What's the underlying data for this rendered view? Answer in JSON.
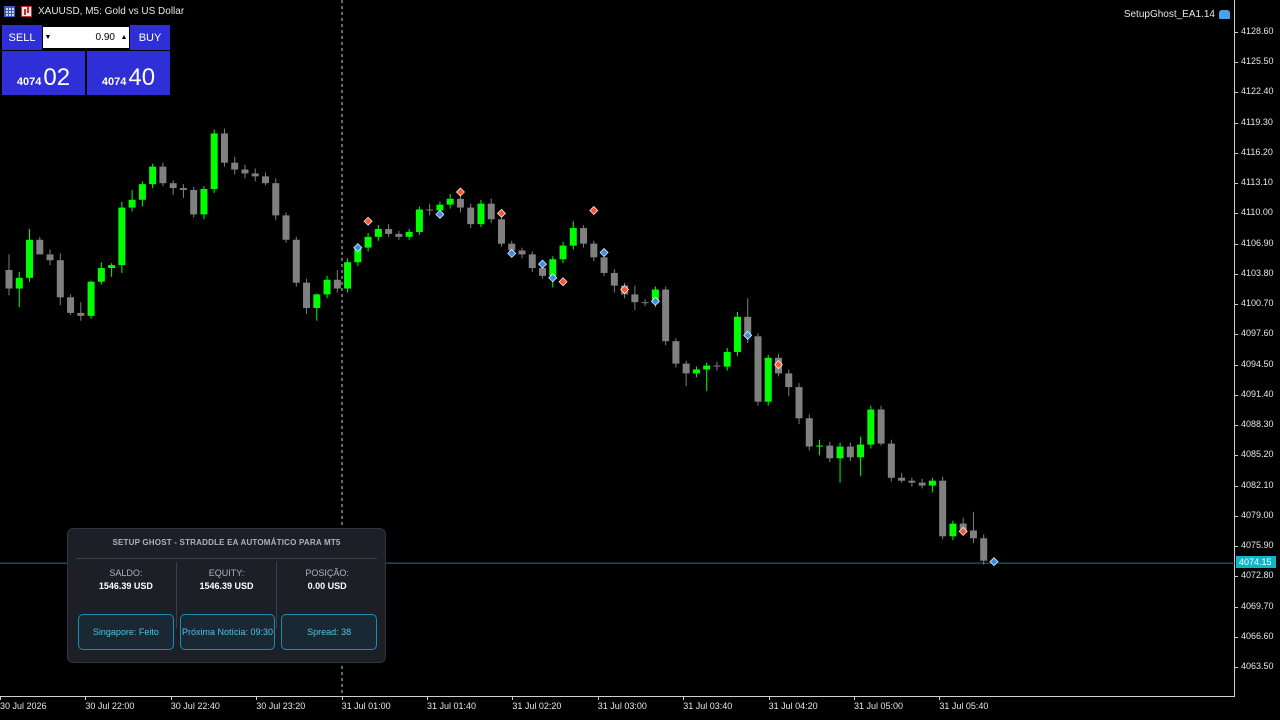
{
  "window": {
    "symbol_title": "XAUUSD, M5:  Gold vs US Dollar",
    "ea_name": "SetupGhost_EA1.14",
    "icons": [
      "chart-grid-icon",
      "chart-bars-icon",
      "expert-hat-icon"
    ]
  },
  "one_click": {
    "sell_label": "SELL",
    "buy_label": "BUY",
    "volume": "0.90",
    "bid_small": "4074",
    "bid_big": "02",
    "ask_small": "4074",
    "ask_big": "40",
    "color": "#2f2fd7"
  },
  "price_axis": {
    "ticks": [
      "4128.60",
      "4125.50",
      "4122.40",
      "4119.30",
      "4116.20",
      "4113.10",
      "4110.00",
      "4106.90",
      "4103.80",
      "4100.70",
      "4097.60",
      "4094.50",
      "4091.40",
      "4088.30",
      "4085.20",
      "4082.10",
      "4079.00",
      "4075.90",
      "4072.80",
      "4069.70",
      "4066.60",
      "4063.50"
    ],
    "current_price": "4074.15",
    "current_price_color": "#0fb6c8"
  },
  "time_axis": {
    "labels": [
      "30 Jul 2026",
      "30 Jul 22:00",
      "30 Jul 22:40",
      "30 Jul 23:20",
      "31 Jul 01:00",
      "31 Jul 01:40",
      "31 Jul 02:20",
      "31 Jul 03:00",
      "31 Jul 03:40",
      "31 Jul 04:20",
      "31 Jul 05:00",
      "31 Jul 05:40"
    ]
  },
  "dashboard": {
    "title": "SETUP GHOST - STRADDLE EA AUTOMÁTICO PARA MT5",
    "saldo_label": "SALDO:",
    "saldo_value": "1546.39 USD",
    "equity_label": "EQUITY:",
    "equity_value": "1546.39 USD",
    "posicao_label": "POSIÇÃO:",
    "posicao_value": "0.00 USD",
    "session_button": "Singapore: Feito",
    "news_button": "Próxima Notícia: 09:30",
    "spread_button": "Spread: 38"
  },
  "chart_data": {
    "type": "candlestick",
    "bull_color": "#00ff00",
    "bear_color": "#808080",
    "y_range": [
      4061.9,
      4130.1
    ],
    "candles": [
      {
        "o": 4104.2,
        "h": 4105.8,
        "l": 4101.6,
        "c": 4102.3
      },
      {
        "o": 4102.3,
        "h": 4104.0,
        "l": 4100.4,
        "c": 4103.4
      },
      {
        "o": 4103.4,
        "h": 4108.4,
        "l": 4103.0,
        "c": 4107.3
      },
      {
        "o": 4107.3,
        "h": 4107.6,
        "l": 4105.8,
        "c": 4105.8
      },
      {
        "o": 4105.8,
        "h": 4106.3,
        "l": 4104.7,
        "c": 4105.2
      },
      {
        "o": 4105.2,
        "h": 4105.9,
        "l": 4100.6,
        "c": 4101.4
      },
      {
        "o": 4101.4,
        "h": 4101.7,
        "l": 4099.6,
        "c": 4099.8
      },
      {
        "o": 4099.8,
        "h": 4100.9,
        "l": 4099.0,
        "c": 4099.5
      },
      {
        "o": 4099.5,
        "h": 4103.1,
        "l": 4099.2,
        "c": 4103.0
      },
      {
        "o": 4103.0,
        "h": 4105.0,
        "l": 4102.7,
        "c": 4104.4
      },
      {
        "o": 4104.4,
        "h": 4104.9,
        "l": 4103.5,
        "c": 4104.7
      },
      {
        "o": 4104.7,
        "h": 4111.2,
        "l": 4103.9,
        "c": 4110.6
      },
      {
        "o": 4110.6,
        "h": 4112.4,
        "l": 4110.2,
        "c": 4111.4
      },
      {
        "o": 4111.4,
        "h": 4113.3,
        "l": 4110.7,
        "c": 4113.0
      },
      {
        "o": 4113.0,
        "h": 4115.1,
        "l": 4112.6,
        "c": 4114.8
      },
      {
        "o": 4114.8,
        "h": 4115.2,
        "l": 4112.8,
        "c": 4113.1
      },
      {
        "o": 4113.1,
        "h": 4113.4,
        "l": 4111.9,
        "c": 4112.6
      },
      {
        "o": 4112.6,
        "h": 4113.0,
        "l": 4111.6,
        "c": 4112.4
      },
      {
        "o": 4112.4,
        "h": 4112.7,
        "l": 4109.6,
        "c": 4109.9
      },
      {
        "o": 4109.9,
        "h": 4112.8,
        "l": 4109.4,
        "c": 4112.5
      },
      {
        "o": 4112.5,
        "h": 4118.6,
        "l": 4112.1,
        "c": 4118.2
      },
      {
        "o": 4118.2,
        "h": 4118.7,
        "l": 4114.8,
        "c": 4115.2
      },
      {
        "o": 4115.2,
        "h": 4115.8,
        "l": 4114.0,
        "c": 4114.5
      },
      {
        "o": 4114.5,
        "h": 4115.0,
        "l": 4113.6,
        "c": 4114.1
      },
      {
        "o": 4114.1,
        "h": 4114.6,
        "l": 4113.3,
        "c": 4113.8
      },
      {
        "o": 4113.8,
        "h": 4114.2,
        "l": 4112.9,
        "c": 4113.1
      },
      {
        "o": 4113.1,
        "h": 4113.6,
        "l": 4109.3,
        "c": 4109.8
      },
      {
        "o": 4109.8,
        "h": 4110.1,
        "l": 4107.0,
        "c": 4107.3
      },
      {
        "o": 4107.3,
        "h": 4107.6,
        "l": 4102.5,
        "c": 4102.9
      },
      {
        "o": 4102.9,
        "h": 4103.3,
        "l": 4099.7,
        "c": 4100.3
      },
      {
        "o": 4100.3,
        "h": 4101.8,
        "l": 4099.0,
        "c": 4101.7
      },
      {
        "o": 4101.7,
        "h": 4103.6,
        "l": 4101.3,
        "c": 4103.2
      },
      {
        "o": 4103.2,
        "h": 4104.2,
        "l": 4101.9,
        "c": 4102.3
      },
      {
        "o": 4102.3,
        "h": 4105.4,
        "l": 4101.9,
        "c": 4105.0
      },
      {
        "o": 4105.0,
        "h": 4106.9,
        "l": 4104.6,
        "c": 4106.5
      },
      {
        "o": 4106.5,
        "h": 4108.0,
        "l": 4106.1,
        "c": 4107.6
      },
      {
        "o": 4107.6,
        "h": 4108.8,
        "l": 4107.2,
        "c": 4108.4
      },
      {
        "o": 4108.4,
        "h": 4108.9,
        "l": 4107.6,
        "c": 4107.9
      },
      {
        "o": 4107.9,
        "h": 4108.2,
        "l": 4107.3,
        "c": 4107.6
      },
      {
        "o": 4107.6,
        "h": 4108.4,
        "l": 4107.3,
        "c": 4108.1
      },
      {
        "o": 4108.1,
        "h": 4110.7,
        "l": 4107.8,
        "c": 4110.4
      },
      {
        "o": 4110.4,
        "h": 4111.0,
        "l": 4109.8,
        "c": 4110.3
      },
      {
        "o": 4110.3,
        "h": 4111.2,
        "l": 4109.9,
        "c": 4110.9
      },
      {
        "o": 4110.9,
        "h": 4112.0,
        "l": 4110.5,
        "c": 4111.5
      },
      {
        "o": 4111.5,
        "h": 4111.9,
        "l": 4110.1,
        "c": 4110.6
      },
      {
        "o": 4110.6,
        "h": 4111.0,
        "l": 4108.5,
        "c": 4108.9
      },
      {
        "o": 4108.9,
        "h": 4111.4,
        "l": 4108.6,
        "c": 4111.0
      },
      {
        "o": 4111.0,
        "h": 4111.5,
        "l": 4109.0,
        "c": 4109.4
      },
      {
        "o": 4109.4,
        "h": 4109.8,
        "l": 4106.6,
        "c": 4106.9
      },
      {
        "o": 4106.9,
        "h": 4107.2,
        "l": 4105.9,
        "c": 4106.2
      },
      {
        "o": 4106.2,
        "h": 4106.5,
        "l": 4105.4,
        "c": 4105.8
      },
      {
        "o": 4105.8,
        "h": 4106.1,
        "l": 4104.0,
        "c": 4104.4
      },
      {
        "o": 4104.4,
        "h": 4104.7,
        "l": 4103.3,
        "c": 4103.6
      },
      {
        "o": 4103.6,
        "h": 4105.6,
        "l": 4102.4,
        "c": 4105.3
      },
      {
        "o": 4105.3,
        "h": 4107.1,
        "l": 4104.9,
        "c": 4106.7
      },
      {
        "o": 4106.7,
        "h": 4109.2,
        "l": 4106.3,
        "c": 4108.5
      },
      {
        "o": 4108.5,
        "h": 4108.8,
        "l": 4106.5,
        "c": 4106.9
      },
      {
        "o": 4106.9,
        "h": 4107.2,
        "l": 4105.1,
        "c": 4105.5
      },
      {
        "o": 4105.5,
        "h": 4105.9,
        "l": 4103.6,
        "c": 4103.9
      },
      {
        "o": 4103.9,
        "h": 4104.3,
        "l": 4101.9,
        "c": 4102.6
      },
      {
        "o": 4102.6,
        "h": 4102.9,
        "l": 4101.3,
        "c": 4101.7
      },
      {
        "o": 4101.7,
        "h": 4102.6,
        "l": 4100.1,
        "c": 4100.9
      },
      {
        "o": 4100.9,
        "h": 4101.2,
        "l": 4100.5,
        "c": 4100.8
      },
      {
        "o": 4100.8,
        "h": 4102.5,
        "l": 4100.4,
        "c": 4102.2
      },
      {
        "o": 4102.2,
        "h": 4102.5,
        "l": 4096.5,
        "c": 4096.9
      },
      {
        "o": 4096.9,
        "h": 4097.2,
        "l": 4094.2,
        "c": 4094.6
      },
      {
        "o": 4094.6,
        "h": 4094.9,
        "l": 4092.3,
        "c": 4093.6
      },
      {
        "o": 4093.6,
        "h": 4094.3,
        "l": 4093.2,
        "c": 4094.0
      },
      {
        "o": 4094.0,
        "h": 4094.7,
        "l": 4091.8,
        "c": 4094.4
      },
      {
        "o": 4094.4,
        "h": 4094.8,
        "l": 4093.9,
        "c": 4094.3
      },
      {
        "o": 4094.3,
        "h": 4096.2,
        "l": 4093.9,
        "c": 4095.8
      },
      {
        "o": 4095.8,
        "h": 4099.9,
        "l": 4095.4,
        "c": 4099.4
      },
      {
        "o": 4099.4,
        "h": 4101.3,
        "l": 4096.7,
        "c": 4097.4
      },
      {
        "o": 4097.4,
        "h": 4097.7,
        "l": 4090.3,
        "c": 4090.7
      },
      {
        "o": 4090.7,
        "h": 4095.5,
        "l": 4090.3,
        "c": 4095.2
      },
      {
        "o": 4095.2,
        "h": 4095.6,
        "l": 4093.3,
        "c": 4093.6
      },
      {
        "o": 4093.6,
        "h": 4094.0,
        "l": 4091.3,
        "c": 4092.2
      },
      {
        "o": 4092.2,
        "h": 4092.6,
        "l": 4088.4,
        "c": 4089.0
      },
      {
        "o": 4089.0,
        "h": 4089.4,
        "l": 4085.7,
        "c": 4086.1
      },
      {
        "o": 4086.1,
        "h": 4086.8,
        "l": 4085.2,
        "c": 4086.2
      },
      {
        "o": 4086.2,
        "h": 4086.6,
        "l": 4084.5,
        "c": 4084.9
      },
      {
        "o": 4084.9,
        "h": 4086.5,
        "l": 4082.4,
        "c": 4086.1
      },
      {
        "o": 4086.1,
        "h": 4086.5,
        "l": 4084.6,
        "c": 4085.0
      },
      {
        "o": 4085.0,
        "h": 4087.1,
        "l": 4083.1,
        "c": 4086.3
      },
      {
        "o": 4086.3,
        "h": 4090.3,
        "l": 4085.9,
        "c": 4089.9
      },
      {
        "o": 4089.9,
        "h": 4090.3,
        "l": 4086.2,
        "c": 4086.4
      },
      {
        "o": 4086.4,
        "h": 4086.8,
        "l": 4082.5,
        "c": 4082.9
      },
      {
        "o": 4082.9,
        "h": 4083.4,
        "l": 4082.4,
        "c": 4082.6
      },
      {
        "o": 4082.6,
        "h": 4082.9,
        "l": 4082.0,
        "c": 4082.4
      },
      {
        "o": 4082.4,
        "h": 4082.8,
        "l": 4081.8,
        "c": 4082.1
      },
      {
        "o": 4082.1,
        "h": 4082.9,
        "l": 4081.4,
        "c": 4082.6
      },
      {
        "o": 4082.6,
        "h": 4083.0,
        "l": 4076.6,
        "c": 4076.9
      },
      {
        "o": 4076.9,
        "h": 4078.5,
        "l": 4076.5,
        "c": 4078.2
      },
      {
        "o": 4078.2,
        "h": 4078.8,
        "l": 4077.2,
        "c": 4077.5
      },
      {
        "o": 4077.5,
        "h": 4079.4,
        "l": 4076.2,
        "c": 4076.7
      },
      {
        "o": 4076.7,
        "h": 4077.1,
        "l": 4074.0,
        "c": 4074.4
      }
    ],
    "signal_markers": [
      {
        "i": 34,
        "type": "buy",
        "price": 4106.5
      },
      {
        "i": 35,
        "type": "sell",
        "price": 4109.2
      },
      {
        "i": 42,
        "type": "buy",
        "price": 4109.9
      },
      {
        "i": 44,
        "type": "sell",
        "price": 4112.2
      },
      {
        "i": 48,
        "type": "sell",
        "price": 4110.0
      },
      {
        "i": 49,
        "type": "buy",
        "price": 4105.9
      },
      {
        "i": 52,
        "type": "buy",
        "price": 4104.8
      },
      {
        "i": 53,
        "type": "buy",
        "price": 4103.4
      },
      {
        "i": 54,
        "type": "sell",
        "price": 4103.0
      },
      {
        "i": 57,
        "type": "sell",
        "price": 4110.3
      },
      {
        "i": 58,
        "type": "buy",
        "price": 4106.0
      },
      {
        "i": 60,
        "type": "sell",
        "price": 4102.2
      },
      {
        "i": 63,
        "type": "buy",
        "price": 4101.0
      },
      {
        "i": 72,
        "type": "buy",
        "price": 4097.5
      },
      {
        "i": 75,
        "type": "sell",
        "price": 4094.5
      },
      {
        "i": 93,
        "type": "sell",
        "price": 4077.4
      },
      {
        "i": 96,
        "type": "buy",
        "price": 4074.3
      }
    ]
  }
}
